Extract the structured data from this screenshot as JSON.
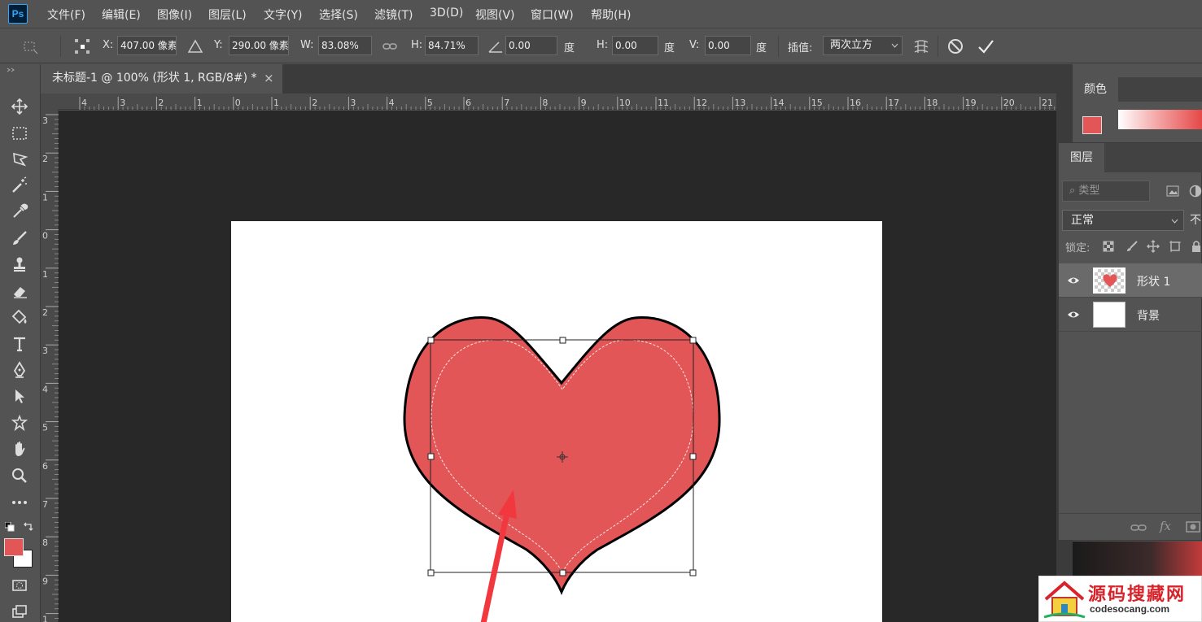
{
  "app": {
    "logo": "Ps"
  },
  "menu": [
    "文件(F)",
    "编辑(E)",
    "图像(I)",
    "图层(L)",
    "文字(Y)",
    "选择(S)",
    "滤镜(T)",
    "3D(D)",
    "视图(V)",
    "窗口(W)",
    "帮助(H)"
  ],
  "options": {
    "x_label": "X:",
    "x_value": "407.00 像素",
    "y_label": "Y:",
    "y_value": "290.00 像素",
    "w_label": "W:",
    "w_value": "83.08%",
    "h_label": "H:",
    "h_value": "84.71%",
    "angle_value": "0.00",
    "angle_unit": "度",
    "skew_h_label": "H:",
    "skew_h_value": "0.00",
    "skew_h_unit": "度",
    "skew_v_label": "V:",
    "skew_v_value": "0.00",
    "skew_v_unit": "度",
    "interp_label": "插值:",
    "interp_value": "两次立方"
  },
  "document": {
    "tab_title": "未标题-1 @ 100% (形状 1, RGB/8#) *",
    "close_glyph": "×"
  },
  "ruler_top": [
    "4",
    "3",
    "2",
    "1",
    "0",
    "1",
    "2",
    "3",
    "4",
    "5",
    "6",
    "7",
    "8",
    "9",
    "10",
    "11",
    "12",
    "13",
    "14",
    "15",
    "16",
    "17",
    "18",
    "19",
    "20",
    "21"
  ],
  "ruler_left": [
    "3",
    "2",
    "1",
    "0",
    "1",
    "2",
    "3",
    "4",
    "5",
    "6",
    "7",
    "8",
    "9",
    "1"
  ],
  "panels": {
    "color_tab": "颜色",
    "layers_tab": "图层",
    "search_placeholder": "类型",
    "blend_mode": "正常",
    "opacity_label": "不",
    "lock_label": "锁定:",
    "layers": [
      {
        "name": "形状 1",
        "selected": true
      },
      {
        "name": "背景",
        "selected": false
      }
    ],
    "footer_fx": "fx"
  },
  "colors": {
    "foreground": "#e35657",
    "background": "#ffffff",
    "heart_fill": "#e35657",
    "arrow": "#f0383e"
  },
  "watermark": {
    "title": "源码搜藏网",
    "url": "codesocang.com"
  }
}
